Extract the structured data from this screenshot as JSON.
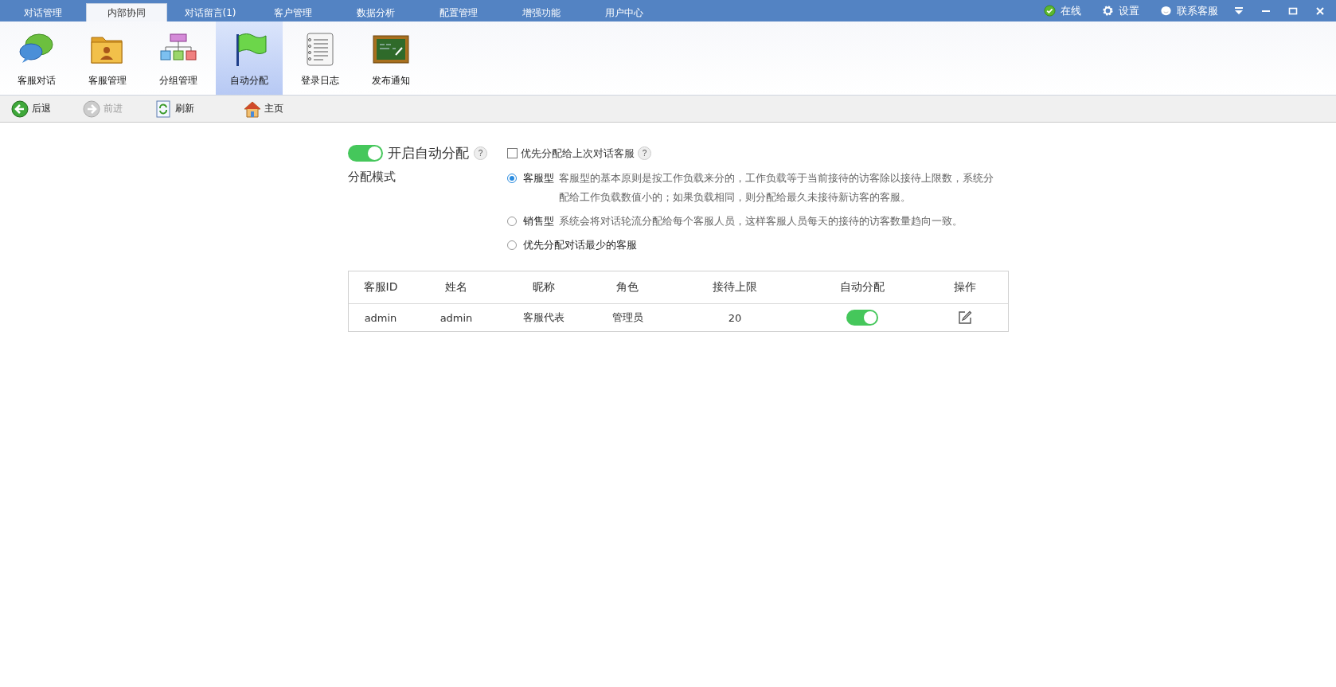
{
  "top_tabs": [
    {
      "label": "对话管理",
      "selected": false
    },
    {
      "label": "内部协同",
      "selected": true
    },
    {
      "label": "对话留言(1)",
      "selected": false
    },
    {
      "label": "客户管理",
      "selected": false
    },
    {
      "label": "数据分析",
      "selected": false
    },
    {
      "label": "配置管理",
      "selected": false
    },
    {
      "label": "增强功能",
      "selected": false
    },
    {
      "label": "用户中心",
      "selected": false
    }
  ],
  "top_links": [
    {
      "kind": "status",
      "label": "在线"
    },
    {
      "kind": "settings",
      "label": "设置"
    },
    {
      "kind": "contact",
      "label": "联系客服"
    }
  ],
  "toolbar": [
    {
      "kind": "chat",
      "label": "客服对话",
      "selected": false
    },
    {
      "kind": "folder",
      "label": "客服管理",
      "selected": false
    },
    {
      "kind": "org",
      "label": "分组管理",
      "selected": false
    },
    {
      "kind": "flag",
      "label": "自动分配",
      "selected": true
    },
    {
      "kind": "log",
      "label": "登录日志",
      "selected": false
    },
    {
      "kind": "board",
      "label": "发布通知",
      "selected": false
    }
  ],
  "nav": [
    {
      "kind": "back",
      "label": "后退",
      "disabled": false
    },
    {
      "kind": "forward",
      "label": "前进",
      "disabled": true
    },
    {
      "kind": "refresh",
      "label": "刷新",
      "disabled": false
    },
    {
      "kind": "home",
      "label": "主页",
      "disabled": false
    }
  ],
  "auto_assign": {
    "label": "开启自动分配",
    "help": "?",
    "on": true
  },
  "prefer_last": {
    "label": "优先分配给上次对话客服",
    "help": "?",
    "checked": false
  },
  "mode_label": "分配模式",
  "modes": [
    {
      "title": "客服型",
      "description": "客服型的基本原则是按工作负载来分的，工作负载等于当前接待的访客除以接待上限数，系统分配给工作负载数值小的；如果负载相同，则分配给最久未接待新访客的客服。",
      "selected": true
    },
    {
      "title": "销售型",
      "description": "系统会将对话轮流分配给每个客服人员，这样客服人员每天的接待的访客数量趋向一致。",
      "selected": false
    },
    {
      "title": "优先分配对话最少的客服",
      "selected": false
    }
  ],
  "table": {
    "columns": [
      "客服ID",
      "姓名",
      "昵称",
      "角色",
      "接待上限",
      "自动分配",
      "操作"
    ],
    "rows": [
      {
        "cells": [
          "admin",
          "admin",
          "客服代表",
          "管理员",
          "20"
        ],
        "auto_assign": true
      }
    ]
  }
}
